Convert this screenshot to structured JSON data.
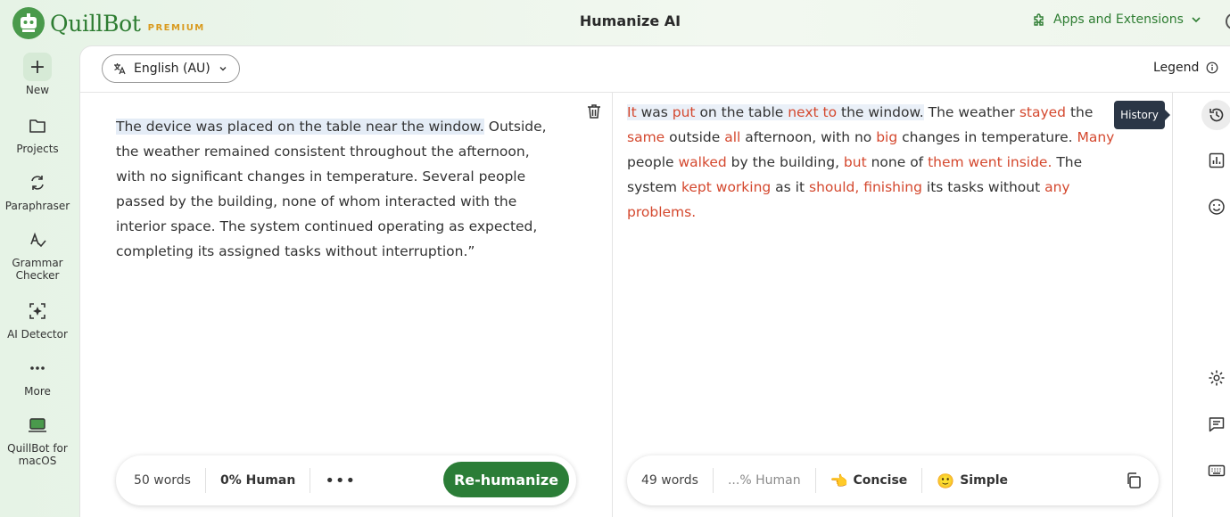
{
  "header": {
    "brand": "QuillBot",
    "tier": "PREMIUM",
    "title": "Humanize AI",
    "apps_label": "Apps and Extensions"
  },
  "sidebar": {
    "items": [
      {
        "label": "New",
        "icon": "plus-icon"
      },
      {
        "label": "Projects",
        "icon": "folder-icon"
      },
      {
        "label": "Paraphraser",
        "icon": "paraphraser-icon"
      },
      {
        "label": "Grammar Checker",
        "icon": "grammar-icon"
      },
      {
        "label": "AI Detector",
        "icon": "ai-detector-icon"
      },
      {
        "label": "More",
        "icon": "more-dots-icon"
      },
      {
        "label": "QuillBot for macOS",
        "icon": "laptop-icon"
      }
    ]
  },
  "toolbar": {
    "language": "English (AU)",
    "legend_label": "Legend"
  },
  "input": {
    "highlight": "The device was placed on the table near the window.",
    "rest": " Outside, the weather remained consistent throughout the afternoon, with no significant changes in temperature. Several people passed by the building, none of whom interacted with the interior space. The system continued operating as expected, completing its assigned tasks without interruption.”",
    "word_count": "50 words",
    "human_score": "0% Human",
    "more_label": "•••",
    "rehumanize_label": "Re-humanize"
  },
  "output": {
    "segments": [
      {
        "t": "It",
        "c": true,
        "h": true
      },
      {
        "t": " was ",
        "c": false,
        "h": true
      },
      {
        "t": "put",
        "c": true,
        "h": true
      },
      {
        "t": " on the table ",
        "c": false,
        "h": true
      },
      {
        "t": "next to",
        "c": true,
        "h": true
      },
      {
        "t": " the window.",
        "c": false,
        "h": true
      },
      {
        "t": " The weather ",
        "c": false,
        "h": false
      },
      {
        "t": "stayed",
        "c": true,
        "h": false
      },
      {
        "t": " the ",
        "c": false,
        "h": false
      },
      {
        "t": "same",
        "c": true,
        "h": false
      },
      {
        "t": " outside ",
        "c": false,
        "h": false
      },
      {
        "t": "all",
        "c": true,
        "h": false
      },
      {
        "t": " afternoon, with no ",
        "c": false,
        "h": false
      },
      {
        "t": "big",
        "c": true,
        "h": false
      },
      {
        "t": " changes in temperature. ",
        "c": false,
        "h": false
      },
      {
        "t": "Many",
        "c": true,
        "h": false
      },
      {
        "t": " people ",
        "c": false,
        "h": false
      },
      {
        "t": "walked",
        "c": true,
        "h": false
      },
      {
        "t": " by the building, ",
        "c": false,
        "h": false
      },
      {
        "t": "but",
        "c": true,
        "h": false
      },
      {
        "t": " none of ",
        "c": false,
        "h": false
      },
      {
        "t": "them went inside.",
        "c": true,
        "h": false
      },
      {
        "t": " The system ",
        "c": false,
        "h": false
      },
      {
        "t": "kept working",
        "c": true,
        "h": false
      },
      {
        "t": " as it ",
        "c": false,
        "h": false
      },
      {
        "t": "should, finishing",
        "c": true,
        "h": false
      },
      {
        "t": " its tasks without ",
        "c": false,
        "h": false
      },
      {
        "t": "any problems.",
        "c": true,
        "h": false
      }
    ],
    "word_count": "49 words",
    "human_score": "...% Human",
    "mode_concise": "Concise",
    "mode_simple": "Simple"
  },
  "rail": {
    "tooltip": "History",
    "icons": [
      "history-icon",
      "chart-icon",
      "smiley-icon",
      "settings-icon",
      "feedback-icon",
      "keyboard-icon"
    ]
  },
  "colors": {
    "brand_green": "#2b7d37",
    "changed_text": "#d4482e",
    "highlight": "#e4ecf6"
  }
}
